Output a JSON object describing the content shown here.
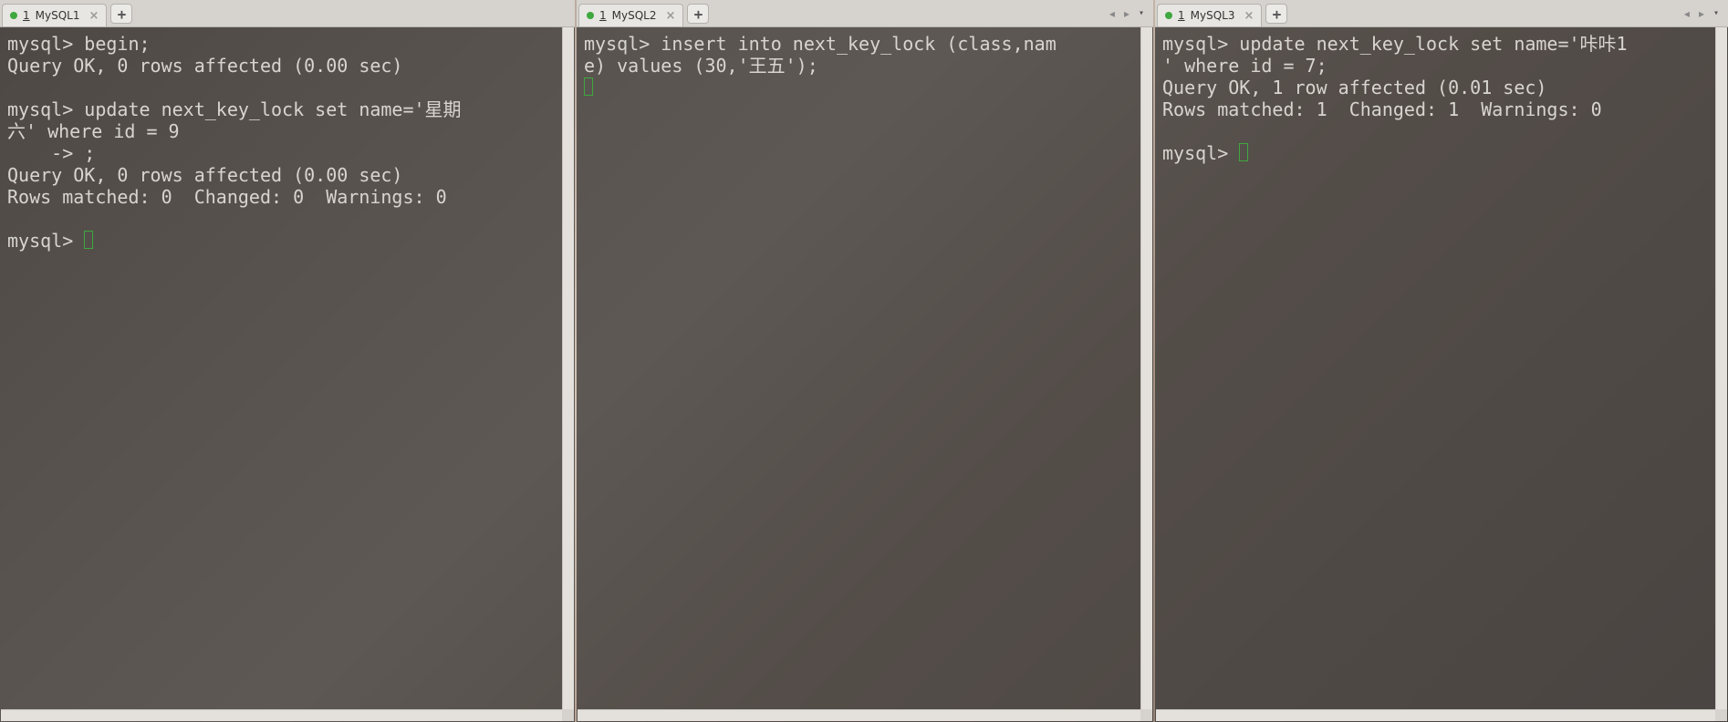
{
  "panes": [
    {
      "tab_num": "1",
      "tab_label": "MySQL1",
      "tab_close": "×",
      "new_tab": "+",
      "content": "mysql> begin;\nQuery OK, 0 rows affected (0.00 sec)\n\nmysql> update next_key_lock set name='星期\n六' where id = 9\n    -> ;\nQuery OK, 0 rows affected (0.00 sec)\nRows matched: 0  Changed: 0  Warnings: 0\n\nmysql> "
    },
    {
      "tab_num": "1",
      "tab_label": "MySQL2",
      "tab_close": "×",
      "new_tab": "+",
      "content": "mysql> insert into next_key_lock (class,nam\ne) values (30,'王五');\n"
    },
    {
      "tab_num": "1",
      "tab_label": "MySQL3",
      "tab_close": "×",
      "new_tab": "+",
      "content": "mysql> update next_key_lock set name='咔咔1\n' where id = 7;\nQuery OK, 1 row affected (0.01 sec)\nRows matched: 1  Changed: 1  Warnings: 0\n\nmysql> "
    }
  ],
  "nav": {
    "prev": "◂",
    "next": "▸",
    "down": "▾"
  },
  "icons": {
    "status_dot": "status-dot-icon"
  }
}
